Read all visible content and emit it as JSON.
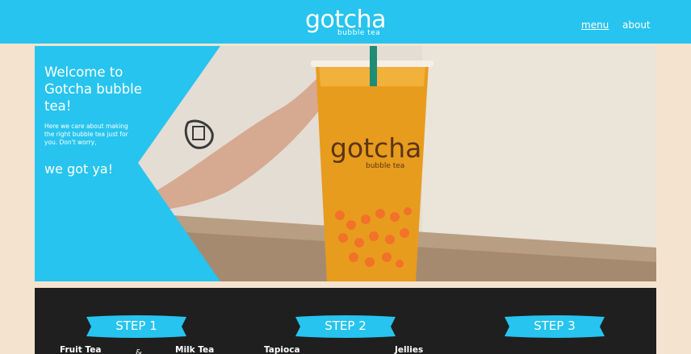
{
  "header": {
    "brand": "gotcha",
    "brand_sub": "bubble tea",
    "nav": [
      {
        "label": "menu"
      },
      {
        "label": "about"
      }
    ]
  },
  "hero": {
    "title": "Welcome to Gotcha bubble tea!",
    "body": "Here we care about making the right bubble tea just for you. Don't worry,",
    "tagline": "we got ya!",
    "cup_brand": "gotcha",
    "cup_brand_sub": "bubble tea"
  },
  "steps": [
    {
      "label": "STEP 1",
      "options": [
        "Fruit Tea",
        "Milk Tea"
      ]
    },
    {
      "label": "STEP 2",
      "options": [
        "Tapioca",
        "Jellies"
      ]
    },
    {
      "label": "STEP 3",
      "options": []
    }
  ],
  "colors": {
    "accent": "#27c4ef",
    "page_bg": "#f4e4cf",
    "steps_bg": "#1f1f1f"
  }
}
